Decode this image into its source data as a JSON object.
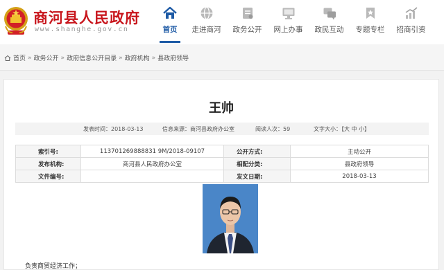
{
  "site": {
    "title": "商河县人民政府",
    "domain": "www.shanghe.gov.cn"
  },
  "nav": [
    {
      "label": "首页",
      "icon": "home-icon",
      "active": true
    },
    {
      "label": "走进商河",
      "icon": "globe-icon"
    },
    {
      "label": "政务公开",
      "icon": "document-icon"
    },
    {
      "label": "网上办事",
      "icon": "monitor-icon"
    },
    {
      "label": "政民互动",
      "icon": "chat-icon"
    },
    {
      "label": "专题专栏",
      "icon": "bookmark-icon"
    },
    {
      "label": "招商引资",
      "icon": "growth-chart-icon"
    }
  ],
  "breadcrumb": [
    "首页",
    "政务公开",
    "政府信息公开目录",
    "政府机构",
    "县政府领导"
  ],
  "article": {
    "title": "王帅",
    "meta": {
      "publish": "发表时间：2018-03-13",
      "source": "信息来源：商河县政府办公室",
      "views": "阅读人次：59",
      "font_size": "文字大小：【大  中  小】"
    },
    "info": {
      "index_label": "索引号:",
      "index_value": "113701269888831 9M/2018-09107",
      "public_label": "公开方式:",
      "public_value": "主动公开",
      "org_label": "发布机构:",
      "org_value": "商河县人民政府办公室",
      "category_label": "相配分类:",
      "category_value": "县政府领导",
      "doc_label": "文件编号:",
      "doc_value": "",
      "date_label": "发文日期:",
      "date_value": "2018-03-13"
    },
    "duty": "负责商贸经济工作；"
  },
  "colors": {
    "brand_red": "#c8161d",
    "nav_blue": "#1d5aa5",
    "photo_bg": "#4a86c8"
  }
}
